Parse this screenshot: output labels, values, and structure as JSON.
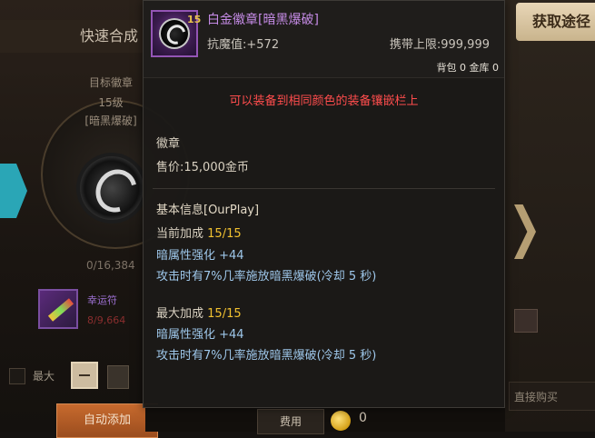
{
  "background": {
    "left_header": "快速合成",
    "target_label": "目标徽章",
    "target_level": "15级",
    "target_name": "[暗黑爆破]",
    "progress": "0/16,384",
    "item_name": "幸运符",
    "item_count": "8/9,664",
    "max_label": "最大",
    "auto_add": "自动添加",
    "acquire_btn": "获取途径",
    "right_label": "直接购买",
    "fee_btn": "费用",
    "coin_count": "0"
  },
  "tooltip": {
    "badge_num": "15",
    "item_name": "白金徽章[暗黑爆破]",
    "resist": "抗魔值:+572",
    "carry_limit": "携带上限:999,999",
    "storage": "背包 0 金库 0",
    "warning": "可以装备到相同颜色的装备镶嵌栏上",
    "category": "徽章",
    "price": "售价:15,000金币",
    "section_title": "基本信息[OurPlay]",
    "current": {
      "label": "当前加成",
      "value": "15/15",
      "stat1": "暗属性强化 +44",
      "stat2": "攻击时有7%几率施放暗黑爆破(冷却 5 秒)"
    },
    "maximum": {
      "label": "最大加成",
      "value": "15/15",
      "stat1": "暗属性强化 +44",
      "stat2": "攻击时有7%几率施放暗黑爆破(冷却 5 秒)"
    }
  },
  "colors": {
    "item_name": "#c58be6",
    "warning": "#ff4d4d",
    "bonus_value": "#f2c230",
    "stat_text": "#9ec7ea"
  }
}
